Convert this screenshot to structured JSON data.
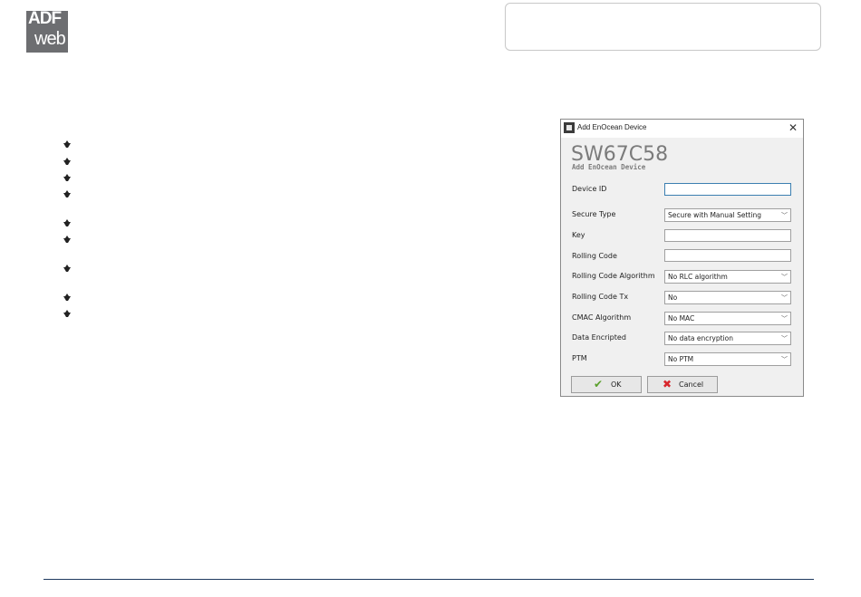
{
  "logo": {
    "line1": "ADF",
    "line2": "web"
  },
  "dialog": {
    "title": "Add EnOcean Device",
    "close": "✕",
    "heading": "SW67C58",
    "subheading": "Add EnOcean Device",
    "fields": {
      "device_id": {
        "label": "Device ID",
        "value": ""
      },
      "secure_type": {
        "label": "Secure Type",
        "value": "Secure with Manual Setting"
      },
      "key": {
        "label": "Key",
        "value": ""
      },
      "rolling_code": {
        "label": "Rolling Code",
        "value": ""
      },
      "rolling_code_algorithm": {
        "label": "Rolling Code Algorithm",
        "value": "No RLC algorithm"
      },
      "rolling_code_tx": {
        "label": "Rolling Code Tx",
        "value": "No"
      },
      "cmac_algorithm": {
        "label": "CMAC Algorithm",
        "value": "No MAC"
      },
      "data_encripted": {
        "label": "Data Encripted",
        "value": "No data encryption"
      },
      "ptm": {
        "label": "PTM",
        "value": "No PTM"
      }
    },
    "ok_label": "OK",
    "cancel_label": "Cancel",
    "ok_icon": "checkmark-icon",
    "cancel_icon": "red-x-icon"
  },
  "chevron": "﹀",
  "colors": {
    "accent_focus": "#3c7fb1",
    "ok_green": "#5aa02c",
    "cancel_red": "#d8262c",
    "footer_line": "#1f3a60"
  }
}
